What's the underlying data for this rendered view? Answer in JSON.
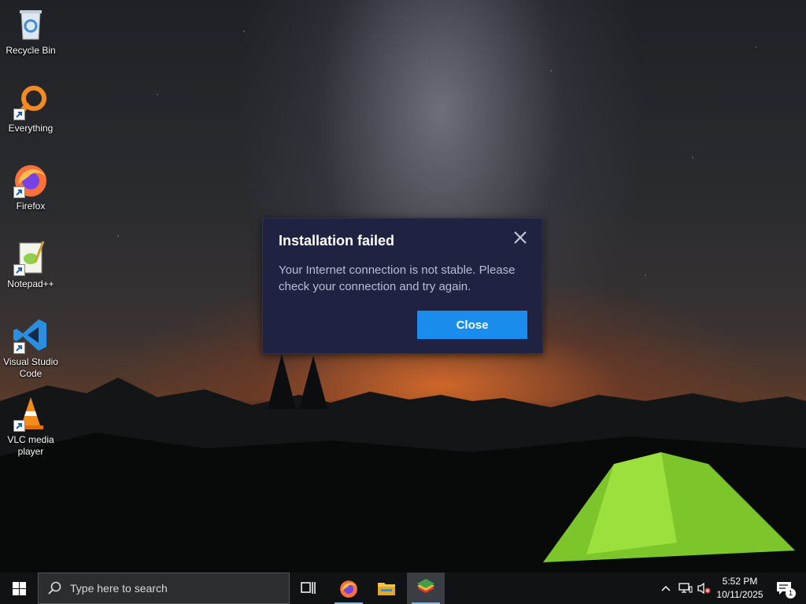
{
  "desktop": {
    "icons": [
      {
        "label": "Recycle Bin",
        "icon": "recycle-bin-icon"
      },
      {
        "label": "Everything",
        "icon": "everything-search-icon"
      },
      {
        "label": "Firefox",
        "icon": "firefox-icon"
      },
      {
        "label": "Notepad++",
        "icon": "notepad-plus-plus-icon"
      },
      {
        "label": "Visual Studio Code",
        "icon": "vscode-icon"
      },
      {
        "label": "VLC media player",
        "icon": "vlc-icon"
      }
    ]
  },
  "dialog": {
    "title": "Installation failed",
    "message": "Your Internet connection is not stable. Please check your connection and try again.",
    "close_button": "Close",
    "accent": "#1a8ceb",
    "background": "#1f2341"
  },
  "taskbar": {
    "search_placeholder": "Type here to search",
    "pinned": [
      "task-view-icon",
      "firefox-icon",
      "file-explorer-icon",
      "bluestacks-icon"
    ],
    "clock_time": "5:52 PM",
    "clock_date": "10/11/2025",
    "notification_count": "1"
  }
}
